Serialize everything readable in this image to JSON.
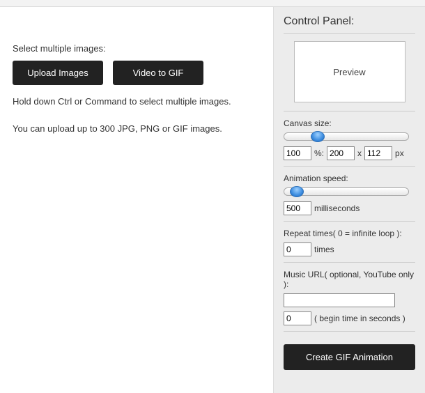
{
  "left": {
    "select_label": "Select multiple images:",
    "upload_btn": "Upload Images",
    "video_btn": "Video to GIF",
    "hint_ctrl": "Hold down Ctrl or Command to select multiple images.",
    "hint_limit": "You can upload up to 300 JPG, PNG or GIF images."
  },
  "panel": {
    "title": "Control Panel:",
    "preview_label": "Preview",
    "canvas": {
      "label": "Canvas size:",
      "percent": "100",
      "percent_unit": "%:",
      "width": "200",
      "x": "x",
      "height": "112",
      "px": "px",
      "slider_pos_pct": 24
    },
    "speed": {
      "label": "Animation speed:",
      "value": "500",
      "unit": "milliseconds",
      "slider_pos_pct": 5
    },
    "repeat": {
      "label": "Repeat times( 0 = infinite loop ):",
      "value": "0",
      "unit": "times"
    },
    "music": {
      "label": "Music URL( optional, YouTube only ):",
      "url": "",
      "begin": "0",
      "begin_unit": "( begin time in seconds )"
    },
    "create_btn": "Create GIF Animation"
  }
}
